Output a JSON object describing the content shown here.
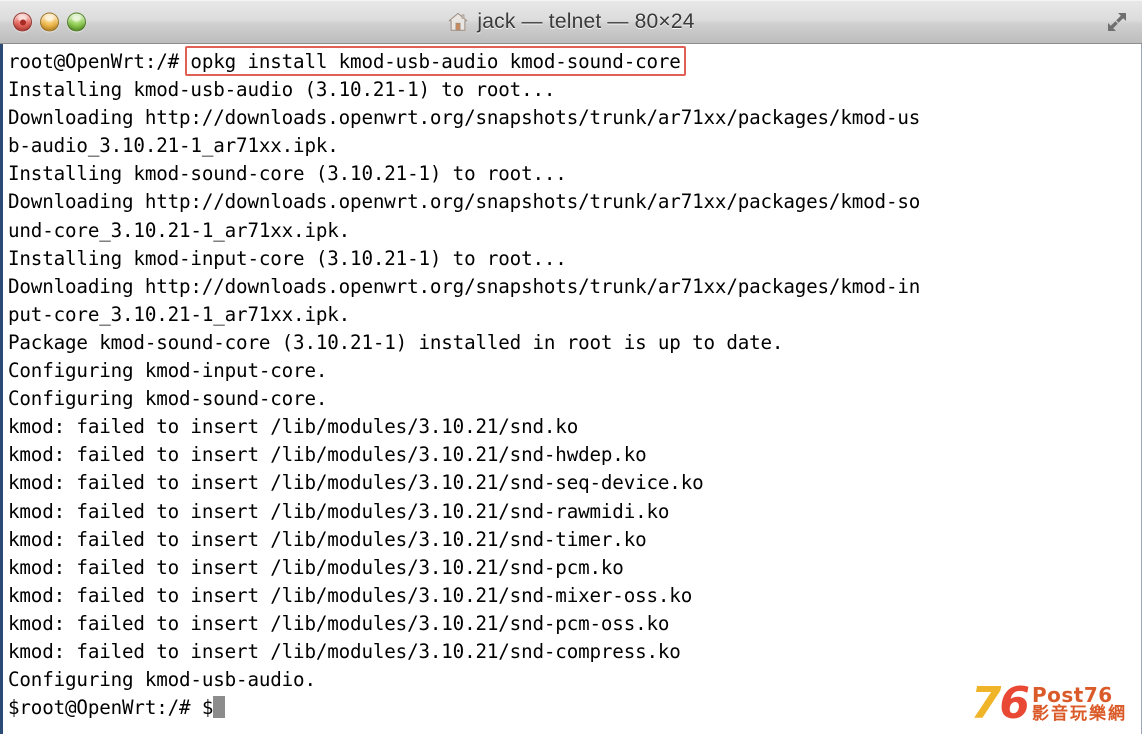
{
  "window": {
    "title": "jack — telnet — 80×24",
    "title_icon": "house-icon",
    "controls": {
      "close_label": "",
      "minimize_label": "",
      "zoom_label": "",
      "fullscreen_label": ""
    }
  },
  "terminal": {
    "prompt": "root@OpenWrt:/#",
    "command": "opkg install kmod-usb-audio kmod-sound-core",
    "highlight_color": "#e06055",
    "cursor": "block",
    "lines": [
      "root@OpenWrt:/# opkg install kmod-usb-audio kmod-sound-core",
      "Installing kmod-usb-audio (3.10.21-1) to root...",
      "Downloading http://downloads.openwrt.org/snapshots/trunk/ar71xx/packages/kmod-us",
      "b-audio_3.10.21-1_ar71xx.ipk.",
      "Installing kmod-sound-core (3.10.21-1) to root...",
      "Downloading http://downloads.openwrt.org/snapshots/trunk/ar71xx/packages/kmod-so",
      "und-core_3.10.21-1_ar71xx.ipk.",
      "Installing kmod-input-core (3.10.21-1) to root...",
      "Downloading http://downloads.openwrt.org/snapshots/trunk/ar71xx/packages/kmod-in",
      "put-core_3.10.21-1_ar71xx.ipk.",
      "Package kmod-sound-core (3.10.21-1) installed in root is up to date.",
      "Configuring kmod-input-core.",
      "Configuring kmod-sound-core.",
      "kmod: failed to insert /lib/modules/3.10.21/snd.ko",
      "kmod: failed to insert /lib/modules/3.10.21/snd-hwdep.ko",
      "kmod: failed to insert /lib/modules/3.10.21/snd-seq-device.ko",
      "kmod: failed to insert /lib/modules/3.10.21/snd-rawmidi.ko",
      "kmod: failed to insert /lib/modules/3.10.21/snd-timer.ko",
      "kmod: failed to insert /lib/modules/3.10.21/snd-pcm.ko",
      "kmod: failed to insert /lib/modules/3.10.21/snd-mixer-oss.ko",
      "kmod: failed to insert /lib/modules/3.10.21/snd-pcm-oss.ko",
      "kmod: failed to insert /lib/modules/3.10.21/snd-compress.ko",
      "Configuring kmod-usb-audio.",
      "$root@OpenWrt:/# $"
    ]
  },
  "watermark": {
    "logo_digit_7": "7",
    "logo_digit_6": "6",
    "brand": "Post76",
    "tagline": "影音玩樂網",
    "color_7": "#f0b01e",
    "color_6": "#e8402a",
    "color_text": "#d9531e"
  }
}
